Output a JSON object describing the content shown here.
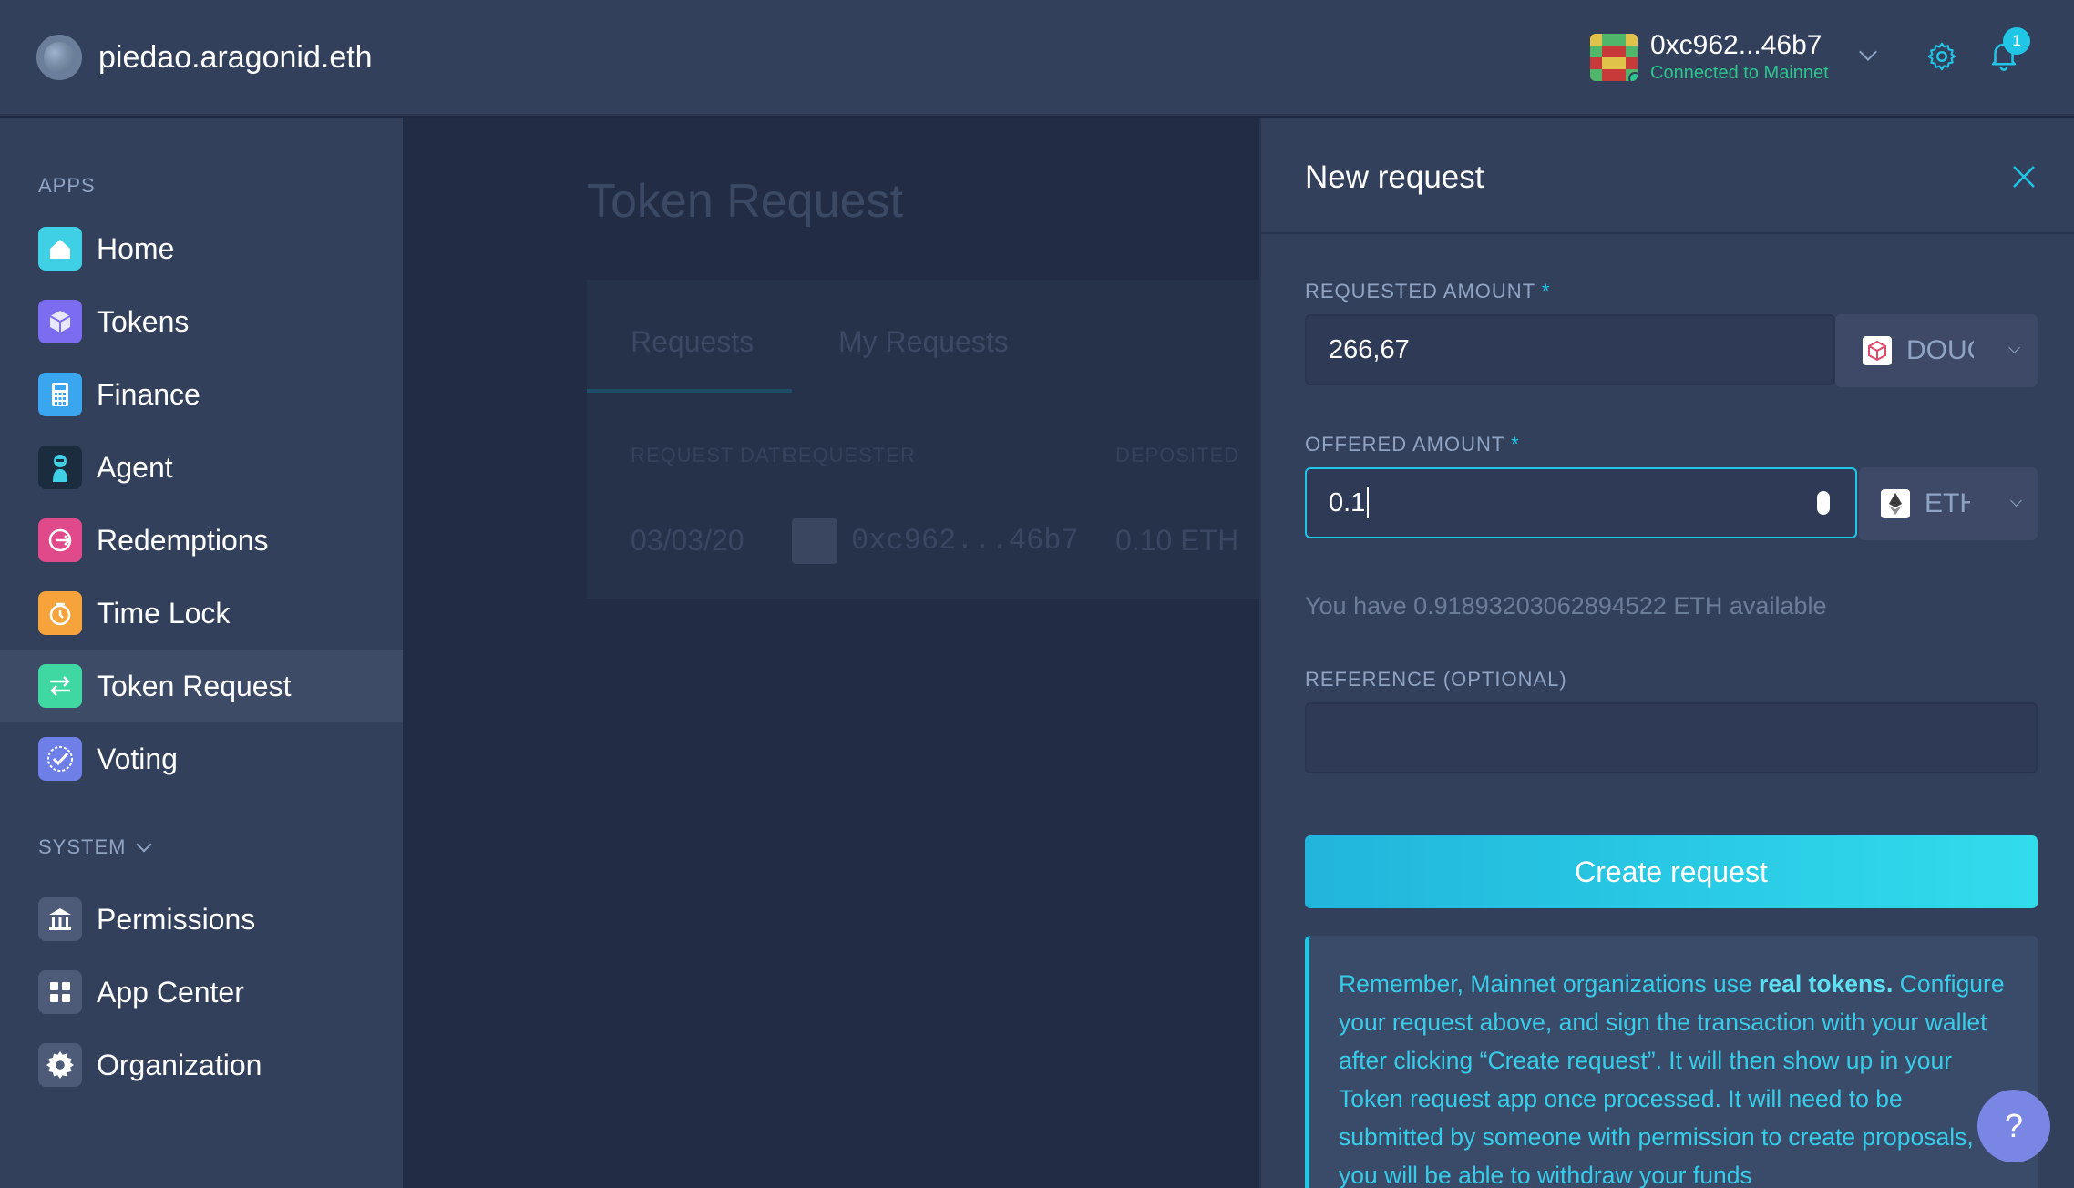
{
  "header": {
    "org_name": "piedao.aragonid.eth",
    "account_address": "0xc962...46b7",
    "account_status": "Connected to Mainnet",
    "notification_count": "1"
  },
  "sidebar": {
    "apps_label": "APPS",
    "system_label": "SYSTEM",
    "apps": [
      {
        "label": "Home",
        "icon": "home-icon",
        "color": "#3fd0e6"
      },
      {
        "label": "Tokens",
        "icon": "tokens-icon",
        "color": "#7b6cf0"
      },
      {
        "label": "Finance",
        "icon": "finance-icon",
        "color": "#3aa6f0"
      },
      {
        "label": "Agent",
        "icon": "agent-icon",
        "color": "#1a2c3e"
      },
      {
        "label": "Redemptions",
        "icon": "redemptions-icon",
        "color": "#e04a8a"
      },
      {
        "label": "Time Lock",
        "icon": "time-lock-icon",
        "color": "#f6a33c"
      },
      {
        "label": "Token Request",
        "icon": "token-request-icon",
        "color": "#3fd8a2"
      },
      {
        "label": "Voting",
        "icon": "voting-icon",
        "color": "#6f7fe8"
      }
    ],
    "system": [
      {
        "label": "Permissions",
        "icon": "permissions-icon"
      },
      {
        "label": "App Center",
        "icon": "app-center-icon"
      },
      {
        "label": "Organization",
        "icon": "organization-icon"
      }
    ]
  },
  "main": {
    "title": "Token Request",
    "tabs": [
      "Requests",
      "My Requests"
    ],
    "columns": [
      "REQUEST DATE",
      "REQUESTER",
      "DEPOSITED"
    ],
    "row": {
      "date": "03/03/20",
      "requester": "0xc962...46b7",
      "deposited": "0.10 ETH"
    }
  },
  "panel": {
    "title": "New request",
    "requested_label": "REQUESTED AMOUNT",
    "requested_value": "266,67",
    "requested_token": "DOUGH",
    "offered_label": "OFFERED AMOUNT",
    "offered_value": "0.1",
    "offered_token": "ETH",
    "required_mark": "*",
    "available_text": "You have 0.91893203062894522 ETH available",
    "reference_label": "REFERENCE (OPTIONAL)",
    "reference_value": "",
    "submit_label": "Create request",
    "info_prefix": "Remember, Mainnet organizations use ",
    "info_bold": "real tokens.",
    "info_rest": " Configure your request above, and sign the transaction with your wallet after clicking “Create request”. It will then show up in your Token request app once processed. It will need to be submitted by someone with permission to create proposals, you will be able to withdraw your funds",
    "help_label": "?"
  }
}
